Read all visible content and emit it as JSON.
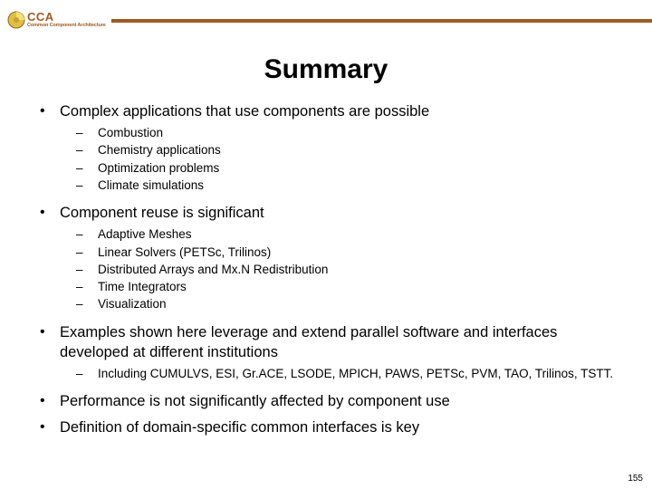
{
  "header": {
    "acronym": "CCA",
    "subtitle": "Common Component Architecture",
    "accent_color": "#9d5b22"
  },
  "title": "Summary",
  "bullets": [
    {
      "text": "Complex applications that use components are possible",
      "sub": [
        "Combustion",
        "Chemistry applications",
        "Optimization problems",
        "Climate simulations"
      ]
    },
    {
      "text": "Component reuse is significant",
      "sub": [
        "Adaptive Meshes",
        "Linear Solvers (PETSc, Trilinos)",
        "Distributed Arrays and Mx.N Redistribution",
        "Time Integrators",
        "Visualization"
      ]
    },
    {
      "text": "Examples shown here leverage and extend parallel software and interfaces developed at different institutions",
      "sub": [
        "Including CUMULVS, ESI, Gr.ACE, LSODE, MPICH, PAWS, PETSc, PVM, TAO, Trilinos, TSTT."
      ]
    },
    {
      "text": "Performance is not significantly affected by component use",
      "sub": []
    },
    {
      "text": "Definition of domain-specific common interfaces is key",
      "sub": []
    }
  ],
  "page_number": "155"
}
